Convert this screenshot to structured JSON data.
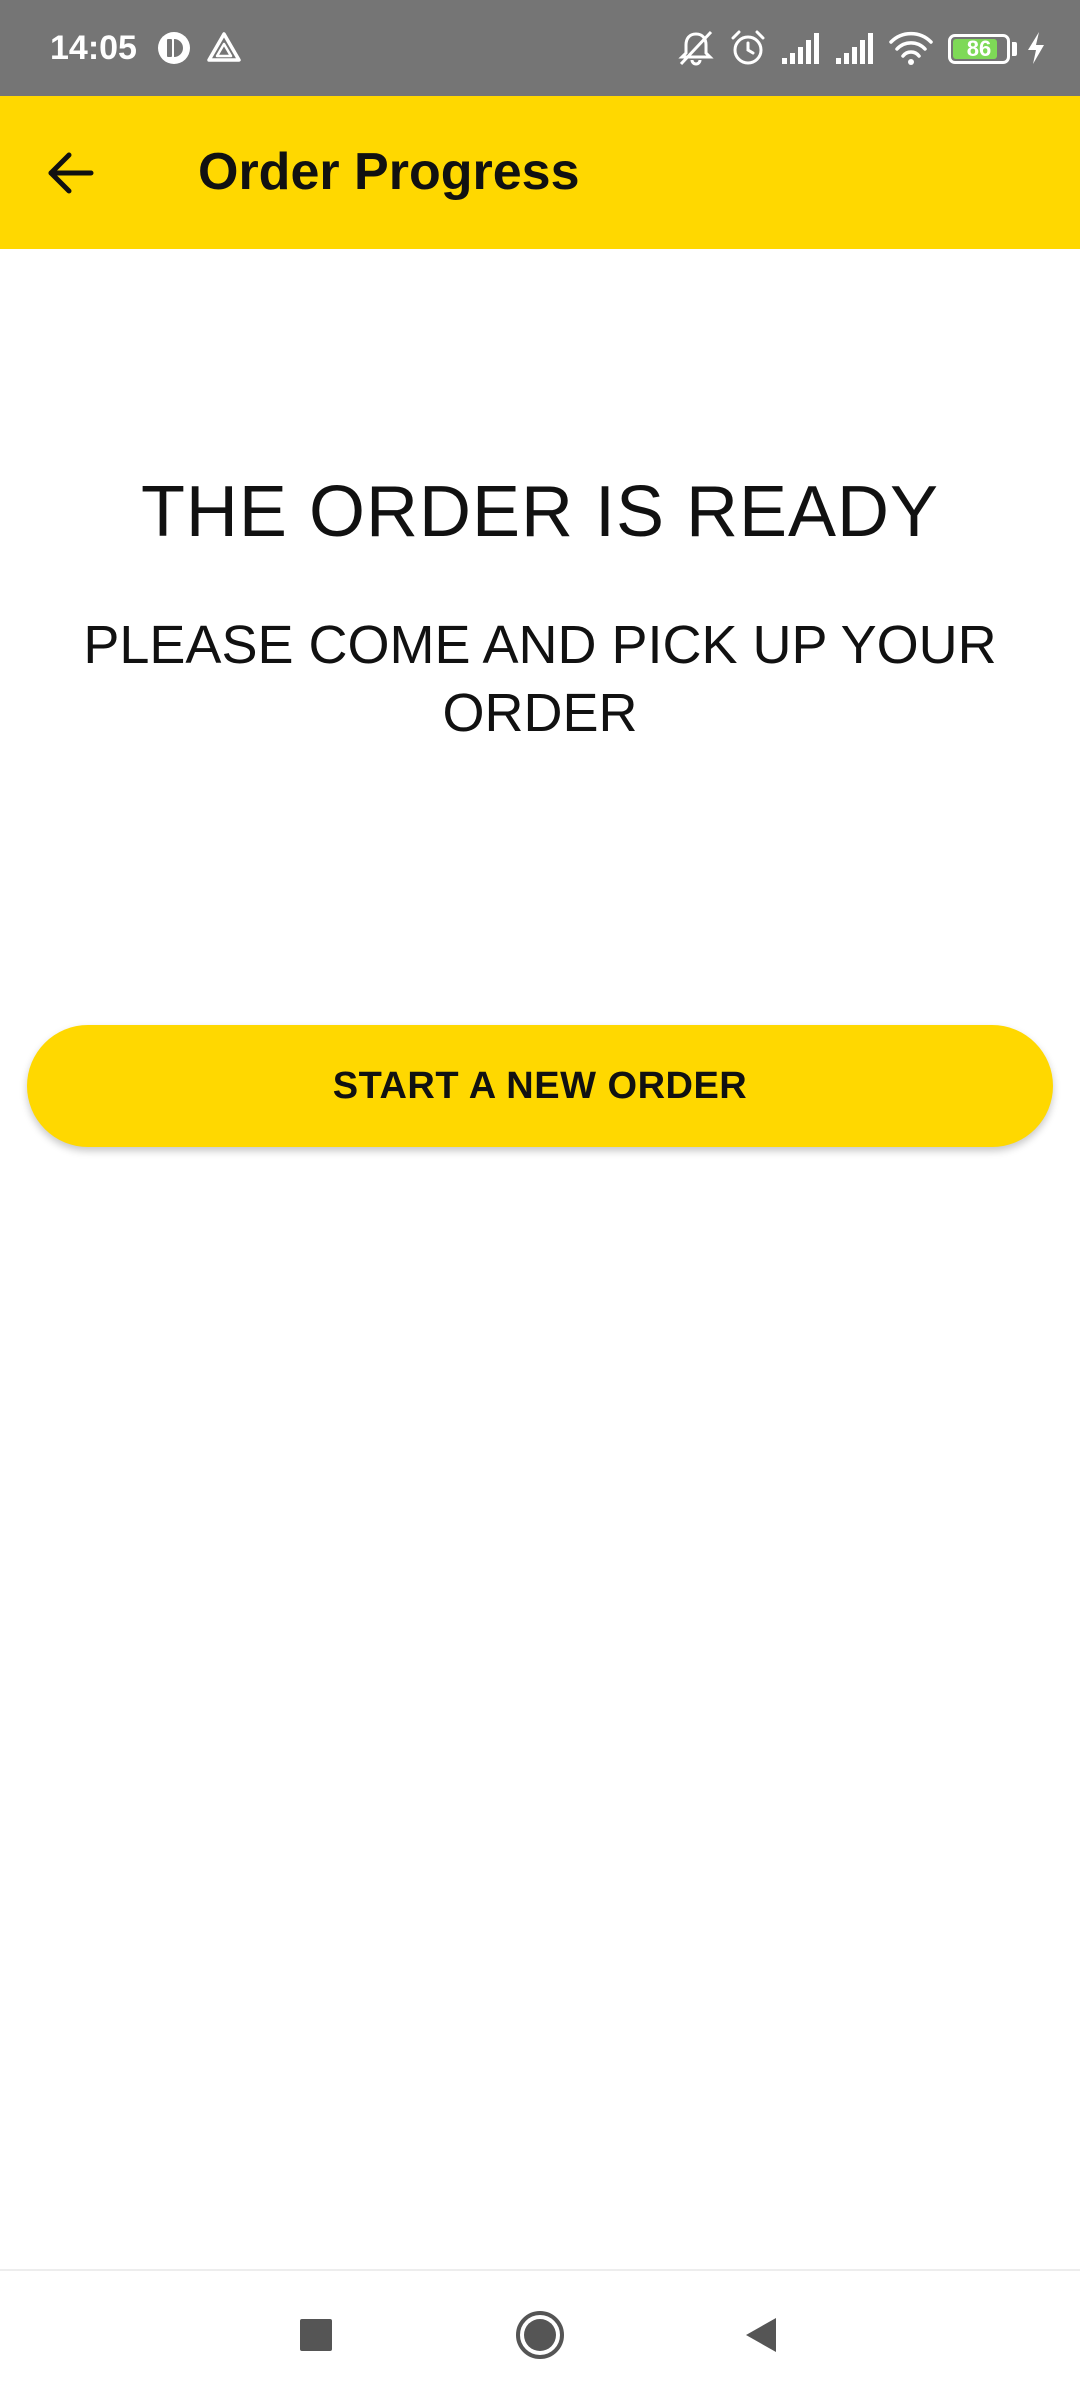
{
  "status_bar": {
    "time": "14:05",
    "battery_level": "86",
    "battery_fraction": 0.86,
    "icons_left": [
      "app-notification-icon",
      "triangle-app-icon"
    ],
    "icons_right": [
      "bell-off-icon",
      "alarm-icon",
      "signal-icon",
      "signal-icon",
      "wifi-icon",
      "battery-icon",
      "charging-icon"
    ]
  },
  "app_bar": {
    "title": "Order Progress",
    "back_icon": "arrow-left-icon",
    "background_color": "#FFD800"
  },
  "main": {
    "headline": "THE ORDER IS READY",
    "message": "PLEASE COME AND PICK UP YOUR ORDER",
    "primary_button_label": "START A NEW ORDER",
    "accent_color": "#FFD800"
  },
  "nav_bar": {
    "buttons": [
      "recents-square-icon",
      "home-circle-icon",
      "back-triangle-icon"
    ]
  }
}
